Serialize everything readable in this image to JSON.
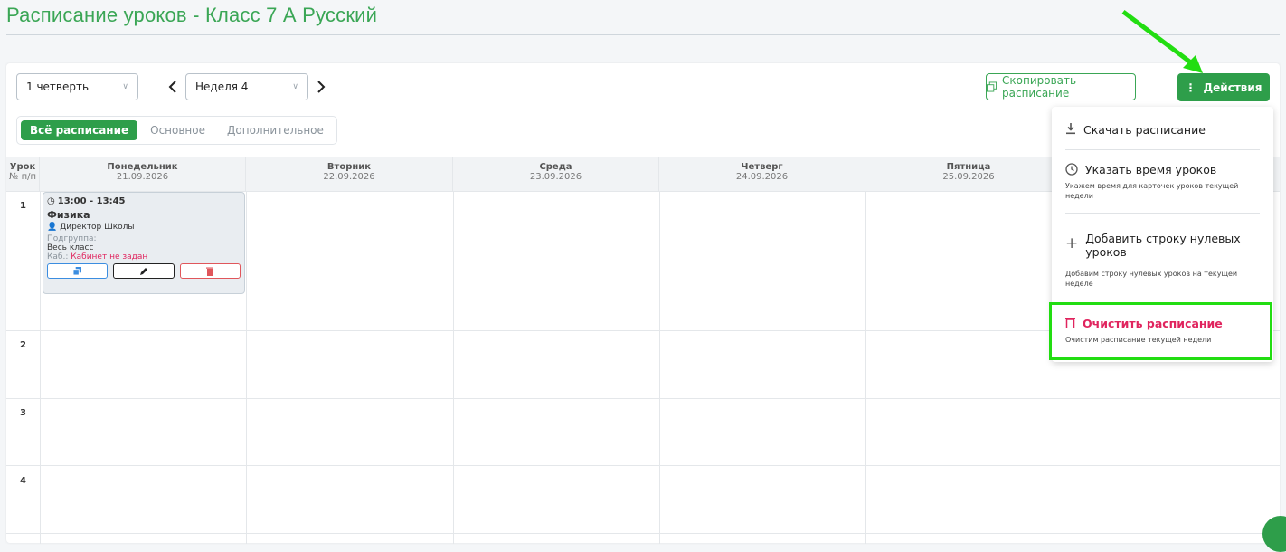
{
  "header": {
    "title": "Расписание уроков - Класс 7 А Русский"
  },
  "filters": {
    "quarter": "1 четверть",
    "week": "Неделя 4"
  },
  "toolbar": {
    "copy_label": "Скопировать расписание",
    "actions_label": "Действия"
  },
  "tabs": [
    {
      "label": "Всё расписание",
      "active": true
    },
    {
      "label": "Основное",
      "active": false
    },
    {
      "label": "Дополнительное",
      "active": false
    }
  ],
  "grid": {
    "lesson_col": {
      "title": "Урок",
      "sub": "№ п/п"
    },
    "days": [
      {
        "name": "Понедельник",
        "date": "21.09.2026"
      },
      {
        "name": "Вторник",
        "date": "22.09.2026"
      },
      {
        "name": "Среда",
        "date": "23.09.2026"
      },
      {
        "name": "Четверг",
        "date": "24.09.2026"
      },
      {
        "name": "Пятница",
        "date": "25.09.2026"
      }
    ],
    "rows": [
      "1",
      "2",
      "3",
      "4"
    ]
  },
  "lesson_card": {
    "time": "13:00 - 13:45",
    "subject": "Физика",
    "teacher": "Директор Школы",
    "subgroup_label": "Подгруппа:",
    "subgroup_value": "Весь класс",
    "room_label": "Каб.:",
    "room_value": "Кабинет не задан"
  },
  "actions_menu": {
    "items": [
      {
        "title": "Скачать расписание",
        "sub": ""
      },
      {
        "title": "Указать время уроков",
        "sub": "Укажем время для карточек уроков текущей недели"
      },
      {
        "title": "Добавить строку нулевых уроков",
        "sub": "Добавим строку нулевых уроков на текущей неделе"
      },
      {
        "title": "Очистить расписание",
        "sub": "Очистим расписание текущей недели"
      }
    ]
  },
  "colors": {
    "brand": "#2e9e4a",
    "danger": "#e0245e",
    "highlight": "#22dd11"
  }
}
